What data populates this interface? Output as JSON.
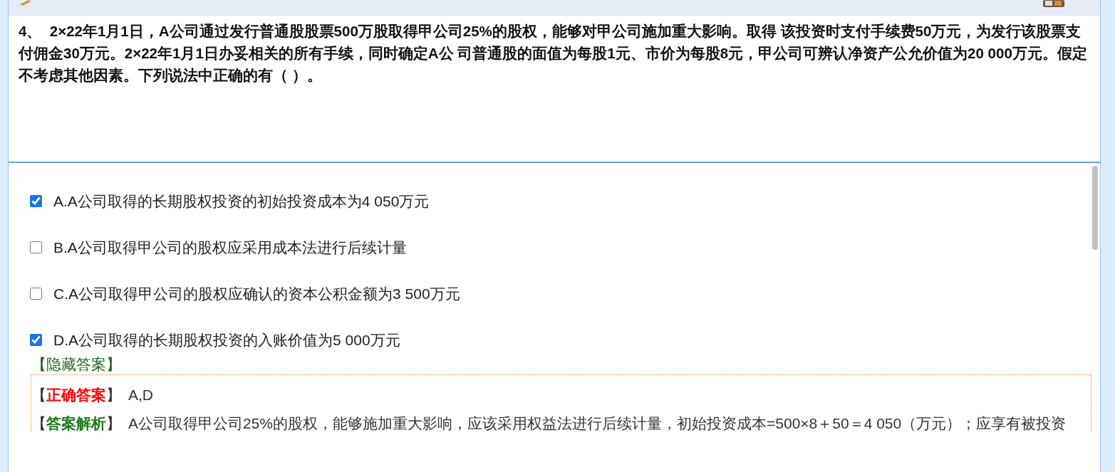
{
  "question": {
    "number": "4、",
    "text": "2×22年1月1日，A公司通过发行普通股股票500万股取得甲公司25%的股权，能够对甲公司施加重大影响。取得 该投资时支付手续费50万元，为发行该股票支付佣金30万元。2×22年1月1日办妥相关的所有手续，同时确定A公 司普通股的面值为每股1元、市价为每股8元，甲公司可辨认净资产公允价值为20 000万元。假定不考虑其他因素。下列说法中正确的有（ ）。"
  },
  "options": [
    {
      "label": "A.A公司取得的长期股权投资的初始投资成本为4 050万元",
      "checked": true
    },
    {
      "label": "B.A公司取得甲公司的股权应采用成本法进行后续计量",
      "checked": false
    },
    {
      "label": "C.A公司取得甲公司的股权应确认的资本公积金额为3 500万元",
      "checked": false
    },
    {
      "label": "D.A公司取得的长期股权投资的入账价值为5 000万元",
      "checked": true
    }
  ],
  "hide_answer": "【隐藏答案】",
  "answer": {
    "open": "【",
    "label": "正确答案",
    "close": "】",
    "value": "A,D"
  },
  "analysis": {
    "open": "【",
    "label": "答案解析",
    "close": "】",
    "text": "A公司取得甲公司25%的股权，能够施加重大影响，应该采用权益法进行后续计量，初始投资成本=500×8＋50＝4 050（万元）；应享有被投资"
  }
}
